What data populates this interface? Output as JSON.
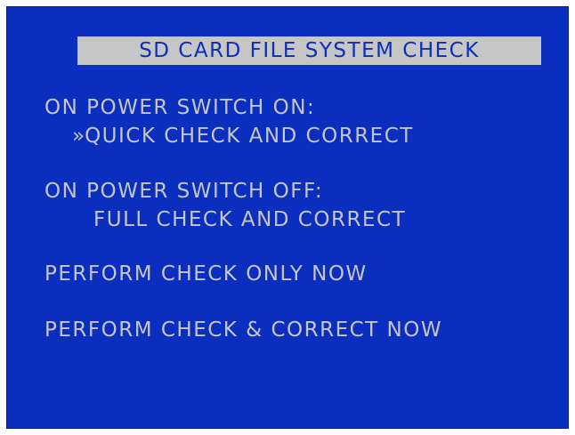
{
  "screen": {
    "title": "SD CARD FILE SYSTEM CHECK",
    "power_on": {
      "heading": "ON POWER SWITCH ON:",
      "selection_marker": "»",
      "value": "QUICK CHECK AND CORRECT"
    },
    "power_off": {
      "heading": "ON POWER SWITCH OFF:",
      "value": "FULL CHECK AND CORRECT"
    },
    "actions": {
      "check_only": "PERFORM CHECK ONLY NOW",
      "check_and_correct": "PERFORM CHECK & CORRECT NOW"
    },
    "colors": {
      "background": "#0a2ebd",
      "text": "#c6c6c6"
    }
  }
}
